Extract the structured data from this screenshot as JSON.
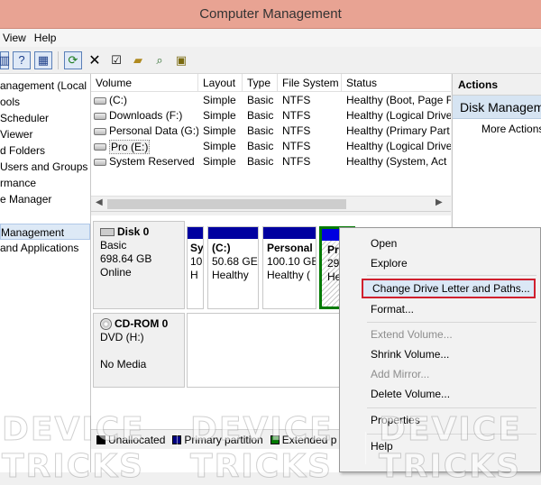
{
  "window": {
    "title": "Computer Management"
  },
  "menubar": {
    "items": [
      "View",
      "Help"
    ]
  },
  "toolbar": {
    "icons": [
      "properties-icon",
      "help-icon",
      "show-hide-icon",
      "refresh-icon",
      "delete-icon",
      "check-icon",
      "open-folder-icon",
      "search-icon",
      "magnify-icon"
    ]
  },
  "tree": {
    "items": [
      "anagement (Local",
      "ools",
      "Scheduler",
      " Viewer",
      "d Folders",
      " Users and Groups",
      "rmance",
      "e Manager",
      "",
      "Management",
      "and Applications"
    ],
    "selected_index": 9
  },
  "volume_list": {
    "columns": [
      "Volume",
      "Layout",
      "Type",
      "File System",
      "Status"
    ],
    "rows": [
      {
        "volume": "(C:)",
        "layout": "Simple",
        "type": "Basic",
        "fs": "NTFS",
        "status": "Healthy (Boot, Page F"
      },
      {
        "volume": "Downloads (F:)",
        "layout": "Simple",
        "type": "Basic",
        "fs": "NTFS",
        "status": "Healthy (Logical Drive"
      },
      {
        "volume": "Personal Data (G:)",
        "layout": "Simple",
        "type": "Basic",
        "fs": "NTFS",
        "status": "Healthy (Primary Part"
      },
      {
        "volume": "Pro (E:)",
        "layout": "Simple",
        "type": "Basic",
        "fs": "NTFS",
        "status": "Healthy (Logical Drive"
      },
      {
        "volume": "System Reserved",
        "layout": "Simple",
        "type": "Basic",
        "fs": "NTFS",
        "status": "Healthy (System, Act"
      }
    ]
  },
  "disks": {
    "disk0": {
      "name": "Disk 0",
      "type": "Basic",
      "size": "698.64 GB",
      "status": "Online"
    },
    "cdrom0": {
      "name": "CD-ROM 0",
      "type": "DVD (H:)",
      "status": "No Media"
    },
    "partitions": [
      {
        "line1": "Sy",
        "line2": "10",
        "line3": "H"
      },
      {
        "line1": "(C:)",
        "line2": "50.68 GE",
        "line3": "Healthy"
      },
      {
        "line1": "Personal",
        "line2": "100.10 GE",
        "line3": "Healthy ("
      },
      {
        "line1": "Pr",
        "line2": "29",
        "line3": "He"
      }
    ]
  },
  "legend": {
    "items": [
      {
        "label": "Unallocated",
        "color": "#000000"
      },
      {
        "label": "Primary partition",
        "color": "#000080"
      },
      {
        "label": "Extended p",
        "color": "#007a00"
      }
    ]
  },
  "actions": {
    "header": "Actions",
    "subheader": "Disk Managem",
    "more": "More Actions"
  },
  "context_menu": {
    "open": "Open",
    "explore": "Explore",
    "change_drive_letter": "Change Drive Letter and Paths...",
    "format": "Format...",
    "extend": "Extend Volume...",
    "shrink": "Shrink Volume...",
    "add_mirror": "Add Mirror...",
    "delete": "Delete Volume...",
    "properties": "Properties",
    "help": "Help",
    "highlight_color": "#d0202f"
  },
  "watermark": {
    "text": "DEVICE TRICKS"
  }
}
